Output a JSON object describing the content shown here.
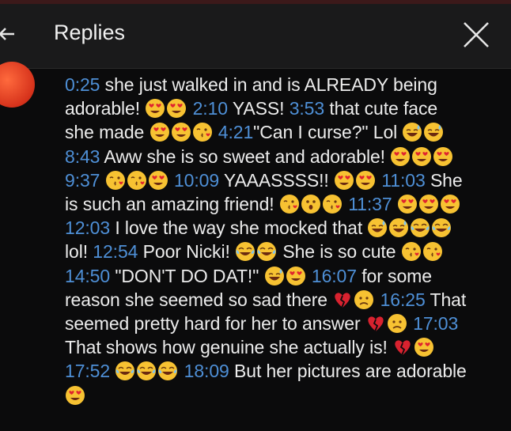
{
  "header": {
    "title": "Replies",
    "back_icon": "arrow-left-icon",
    "close_icon": "close-icon"
  },
  "colors": {
    "background": "#0b0b0c",
    "header_bg": "#1a1a1b",
    "text": "#ececec",
    "timestamp": "#4e8fd6",
    "avatar": "#e0401f"
  },
  "reply": {
    "segments": [
      {
        "ts": "0:25"
      },
      {
        "t": " she just walked in and is ALREADY being adorable! "
      },
      {
        "e": "heart-eyes"
      },
      {
        "e": "heart-eyes"
      },
      {
        "t": " "
      },
      {
        "ts": "2:10"
      },
      {
        "t": " YASS! "
      },
      {
        "ts": "3:53"
      },
      {
        "t": " that cute face she made "
      },
      {
        "e": "heart-eyes"
      },
      {
        "e": "heart-eyes"
      },
      {
        "e": "kiss"
      },
      {
        "t": " "
      },
      {
        "ts": "4:21"
      },
      {
        "t": "\"Can I curse?\" Lol "
      },
      {
        "e": "sweat-smile"
      },
      {
        "e": "sweat-smile"
      },
      {
        "t": " "
      },
      {
        "ts": "8:43"
      },
      {
        "t": " Aww she is so sweet and adorable! "
      },
      {
        "e": "heart-eyes"
      },
      {
        "e": "heart-eyes"
      },
      {
        "e": "heart-eyes"
      },
      {
        "t": " "
      },
      {
        "ts": "9:37"
      },
      {
        "t": " "
      },
      {
        "e": "kiss"
      },
      {
        "e": "kiss"
      },
      {
        "e": "heart-eyes"
      },
      {
        "t": " "
      },
      {
        "ts": "10:09"
      },
      {
        "t": " YAAASSSS!! "
      },
      {
        "e": "heart-eyes"
      },
      {
        "e": "heart-eyes"
      },
      {
        "t": " "
      },
      {
        "ts": "11:03"
      },
      {
        "t": " She is such an amazing friend! "
      },
      {
        "e": "kiss"
      },
      {
        "e": "hushed"
      },
      {
        "e": "kiss"
      },
      {
        "t": " "
      },
      {
        "ts": "11:37"
      },
      {
        "t": " "
      },
      {
        "e": "heart-eyes"
      },
      {
        "e": "heart-eyes"
      },
      {
        "e": "heart-eyes"
      },
      {
        "t": " "
      },
      {
        "ts": "12:03"
      },
      {
        "t": " I love the way she mocked that "
      },
      {
        "e": "sweat-smile"
      },
      {
        "e": "sweat-smile"
      },
      {
        "e": "joy"
      },
      {
        "e": "joy"
      },
      {
        "t": " lol! "
      },
      {
        "ts": "12:54"
      },
      {
        "t": " Poor Nicki! "
      },
      {
        "e": "joy"
      },
      {
        "e": "joy"
      },
      {
        "t": " She is so cute "
      },
      {
        "e": "kiss"
      },
      {
        "e": "kiss"
      },
      {
        "t": " "
      },
      {
        "ts": "14:50"
      },
      {
        "t": " \"DON'T DO DAT!\" "
      },
      {
        "e": "sweat-smile"
      },
      {
        "e": "heart-eyes"
      },
      {
        "t": " "
      },
      {
        "ts": "16:07"
      },
      {
        "t": " for some reason she seemed so sad there "
      },
      {
        "e": "broken-heart"
      },
      {
        "e": "sad"
      },
      {
        "t": " "
      },
      {
        "ts": "16:25"
      },
      {
        "t": " That seemed pretty hard for her to answer "
      },
      {
        "e": "broken-heart"
      },
      {
        "e": "sad"
      },
      {
        "t": " "
      },
      {
        "ts": "17:03"
      },
      {
        "t": " That shows how genuine she actually is! "
      },
      {
        "e": "broken-heart"
      },
      {
        "e": "heart-eyes"
      },
      {
        "t": " "
      },
      {
        "ts": "17:52"
      },
      {
        "t": " "
      },
      {
        "e": "joy"
      },
      {
        "e": "joy"
      },
      {
        "e": "joy"
      },
      {
        "t": " "
      },
      {
        "ts": "18:09"
      },
      {
        "t": " But her pictures are adorable "
      },
      {
        "e": "heart-eyes"
      }
    ]
  }
}
